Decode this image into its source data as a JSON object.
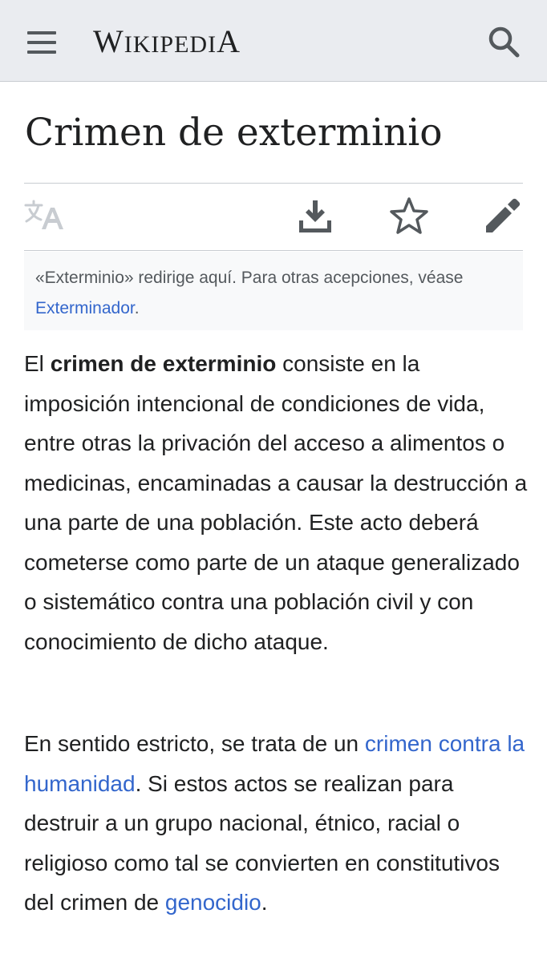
{
  "header": {
    "logo_W": "W",
    "logo_iki": "IKIPEDI",
    "logo_A": "A",
    "logo_text": "Wikipedia"
  },
  "icons": {
    "menu": "menu-icon",
    "search": "search-icon",
    "language": "language-icon",
    "download": "download-icon",
    "watch": "star-icon",
    "edit": "pencil-icon"
  },
  "article": {
    "title": "Crimen de exterminio",
    "hatnote": {
      "text_before": "«Exterminio» redirige aquí. Para otras acepciones, véase ",
      "link": "Exterminador",
      "text_after": "."
    },
    "paragraph1": {
      "lead": "El ",
      "bold": "crimen de exterminio",
      "rest": " consiste en la imposición intencional de condiciones de vida, entre otras la privación del acceso a alimentos o medicinas, encaminadas a causar la destrucción a una parte de una población. Este acto deberá cometerse como parte de un ataque generalizado o sistemático contra una población civil y con conocimiento de dicho ataque."
    },
    "paragraph2": {
      "text1": "En sentido estricto, se trata de un ",
      "link1": "crimen contra la humanidad",
      "text2": ". Si estos actos se realizan para destruir a un grupo nacional, étnico, racial o religioso como tal se convierten en constitutivos del crimen de ",
      "link2": "genocidio",
      "text3": "."
    }
  },
  "colors": {
    "header_bg": "#eaecf0",
    "link": "#3366cc",
    "text": "#202122",
    "muted": "#54595d",
    "disabled_icon": "#c8ccd1"
  }
}
